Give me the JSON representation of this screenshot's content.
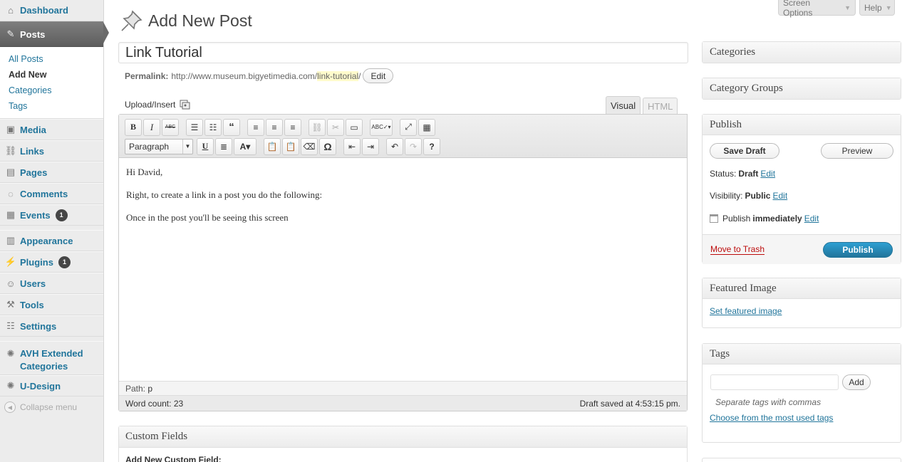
{
  "sidebar": {
    "dashboard": "Dashboard",
    "posts": "Posts",
    "posts_sub": [
      "All Posts",
      "Add New",
      "Categories",
      "Tags"
    ],
    "media": "Media",
    "links": "Links",
    "pages": "Pages",
    "comments": "Comments",
    "events": "Events",
    "events_badge": "1",
    "appearance": "Appearance",
    "plugins": "Plugins",
    "plugins_badge": "1",
    "users": "Users",
    "tools": "Tools",
    "settings": "Settings",
    "avh_line1": "AVH Extended",
    "avh_line2": "Categories",
    "udesign": "U-Design",
    "collapse": "Collapse menu"
  },
  "top": {
    "screen_options": "Screen Options",
    "help": "Help"
  },
  "page": {
    "title": "Add New Post"
  },
  "post": {
    "title": "Link Tutorial",
    "permalink_label": "Permalink:",
    "permalink_base": "http://www.museum.bigyetimedia.com/",
    "permalink_slug": "link-tutorial",
    "permalink_trailing": "/",
    "permalink_edit": "Edit"
  },
  "editor": {
    "upload_label": "Upload/Insert",
    "tab_visual": "Visual",
    "tab_html": "HTML",
    "format_select": "Paragraph",
    "content": [
      "Hi David,",
      "Right, to create a link in a post you do the following:",
      "Once in the post you'll be seeing this screen"
    ],
    "path_label": "Path:",
    "path_value": "p",
    "word_count_label": "Word count:",
    "word_count": "23",
    "draft_saved": "Draft saved at 4:53:15 pm."
  },
  "custom_fields": {
    "title": "Custom Fields",
    "sub": "Add New Custom Field:"
  },
  "boxes": {
    "categories": "Categories",
    "category_groups": "Category Groups",
    "publish": {
      "title": "Publish",
      "save_draft": "Save Draft",
      "preview": "Preview",
      "status_label": "Status:",
      "status_value": "Draft",
      "visibility_label": "Visibility:",
      "visibility_value": "Public",
      "publish_label": "Publish",
      "publish_value": "immediately",
      "edit": "Edit",
      "trash": "Move to Trash",
      "publish_button": "Publish"
    },
    "featured": {
      "title": "Featured Image",
      "link": "Set featured image"
    },
    "tags": {
      "title": "Tags",
      "add": "Add",
      "hint": "Separate tags with commas",
      "most_used": "Choose from the most used tags"
    }
  }
}
